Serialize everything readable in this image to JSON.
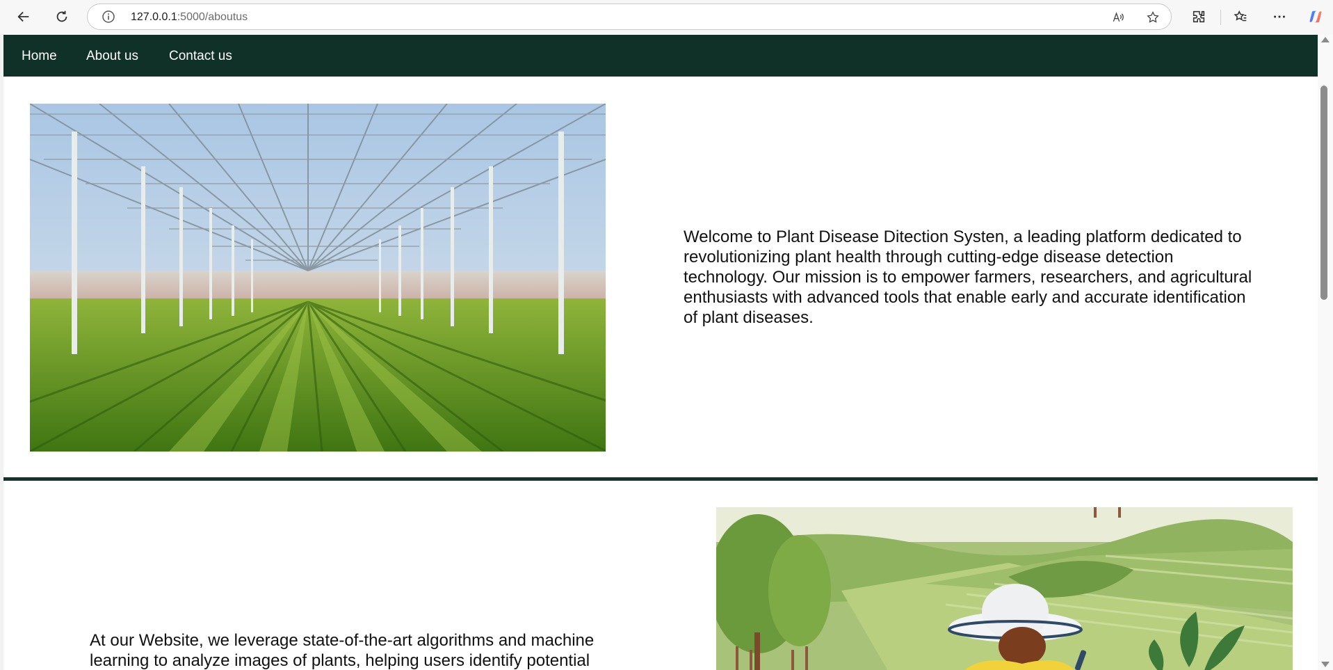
{
  "browser": {
    "url_host": "127.0.0.1",
    "url_path": ":5000/aboutus",
    "icons": [
      "back-arrow-icon",
      "refresh-icon",
      "site-info-icon",
      "read-aloud-icon",
      "favorite-star-icon",
      "extensions-icon",
      "favorites-icon",
      "more-menu-icon",
      "copilot-icon"
    ]
  },
  "nav": {
    "home": "Home",
    "about": "About us",
    "contact": "Contact us",
    "background_color": "#0f3127"
  },
  "section1": {
    "image_description_icon": "greenhouse-image",
    "text": "Welcome to Plant Disease Ditection Systen, a leading platform dedicated to revolutionizing plant health through cutting-edge disease detection technology. Our mission is to empower farmers, researchers, and agricultural enthusiasts with advanced tools that enable early and accurate identification of plant diseases."
  },
  "section2": {
    "image_description_icon": "farmer-illustration-image",
    "text": "At our Website, we leverage state-of-the-art algorithms and machine learning to analyze images of plants, helping users identify potential"
  },
  "colors": {
    "divider": "#16322a",
    "text": "#111111"
  }
}
